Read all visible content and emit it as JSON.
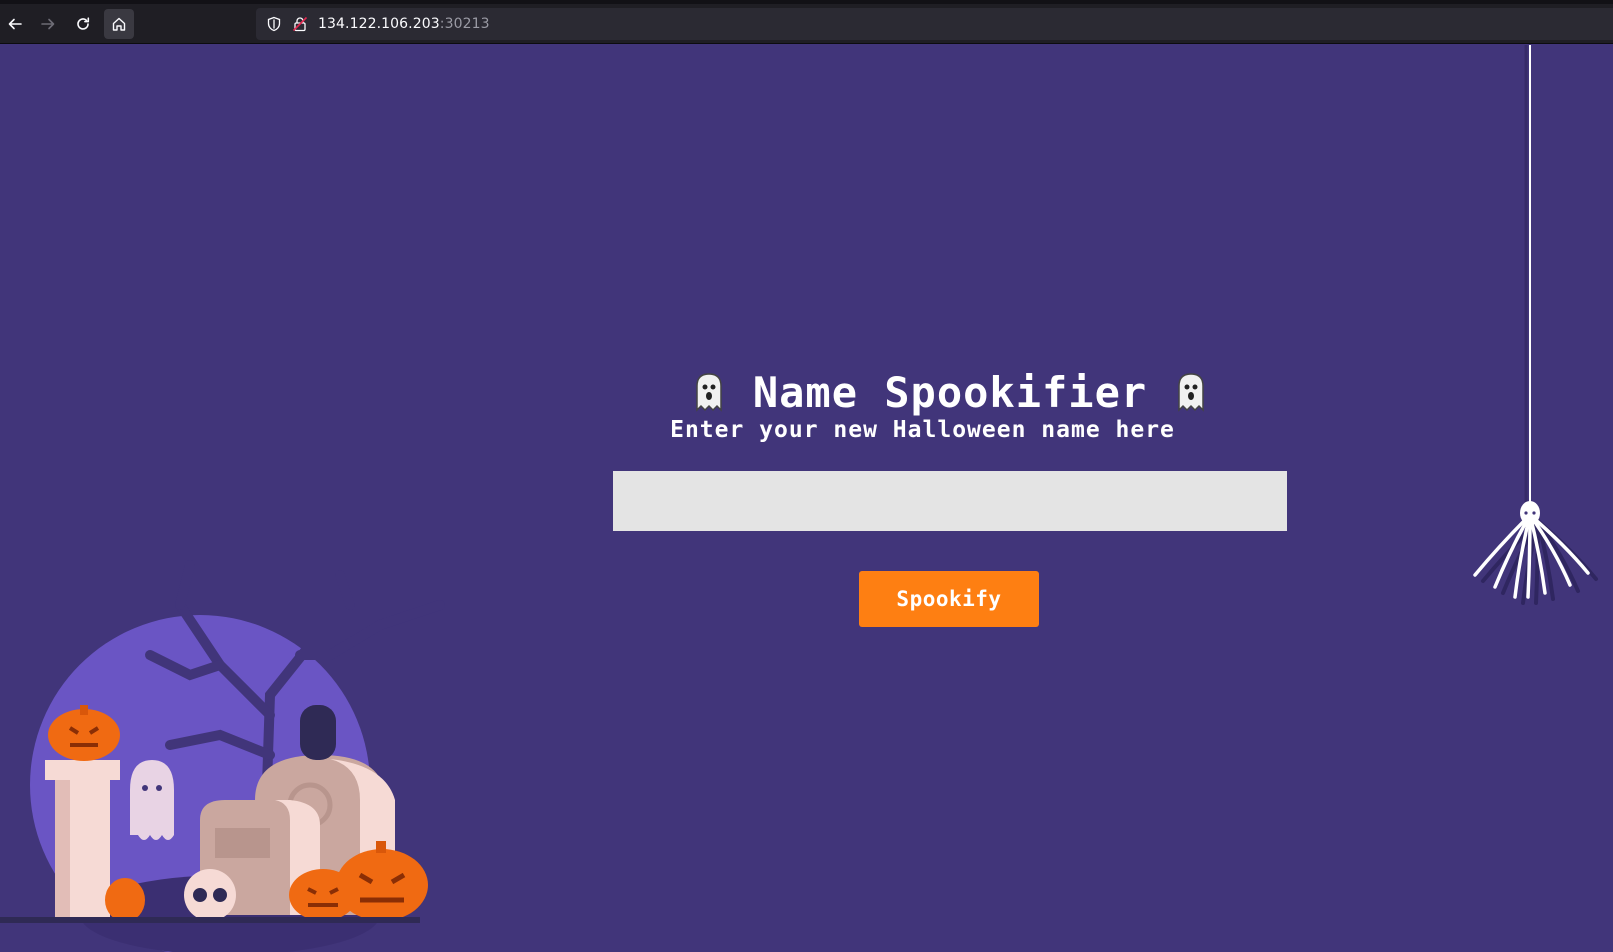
{
  "browser": {
    "url_host": "134.122.106.203",
    "url_port": ":30213"
  },
  "page": {
    "title": "Name Spookifier",
    "subtitle": "Enter your new Halloween name here",
    "input_value": "",
    "button_label": "Spookify"
  },
  "colors": {
    "background": "#41357a",
    "button": "#fe7f12",
    "input": "#e4e4e4",
    "moon": "#6a55c4"
  },
  "icons": [
    "back-arrow-icon",
    "forward-arrow-icon",
    "reload-icon",
    "home-icon",
    "shield-icon",
    "insecure-lock-icon",
    "ghost-icon",
    "spider-icon"
  ]
}
